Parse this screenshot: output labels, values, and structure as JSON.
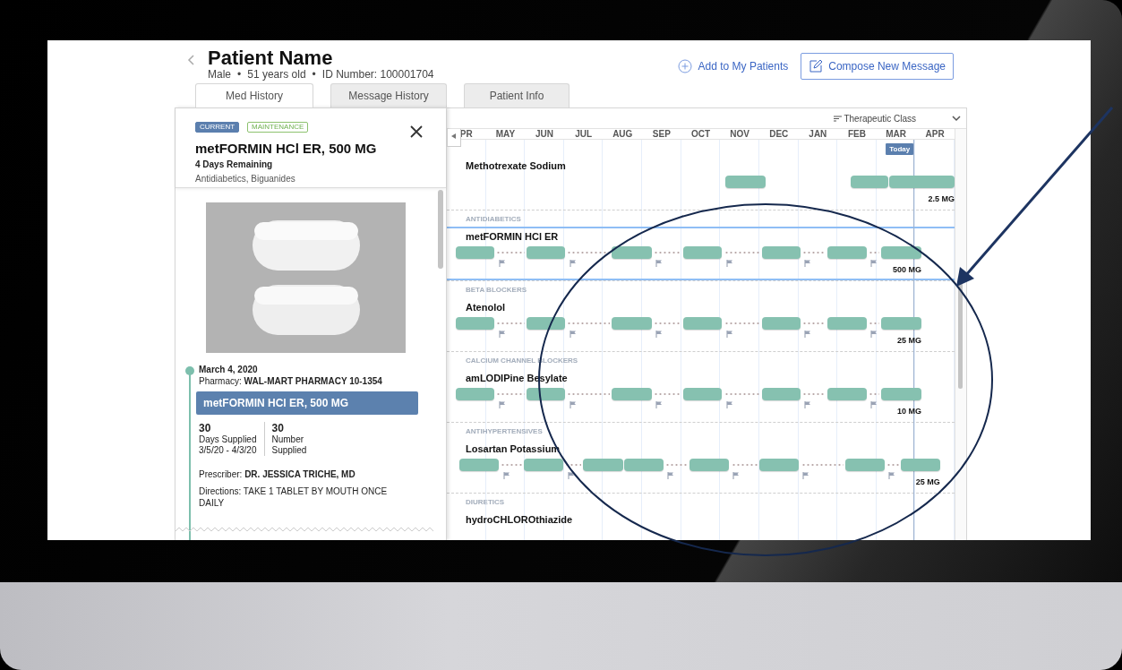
{
  "patient": {
    "name": "Patient Name",
    "separator": "•",
    "details": [
      "Male",
      "51 years old",
      "ID Number: 100001704"
    ]
  },
  "actions": {
    "add": "Add to My Patients",
    "compose": "Compose New Message"
  },
  "tabs": [
    {
      "label": "Med History",
      "selected": true
    },
    {
      "label": "Message History",
      "selected": false
    },
    {
      "label": "Patient Info",
      "selected": false
    }
  ],
  "drug_panel": {
    "badges": [
      {
        "label": "CURRENT",
        "kind": "current"
      },
      {
        "label": "MAINTENANCE",
        "kind": "maintenance"
      }
    ],
    "title": "metFORMIN HCl ER, 500 MG",
    "remaining": "4 Days Remaining",
    "drug_class": "Antidiabetics, Biguanides",
    "fill": {
      "date": "March 4, 2020",
      "pharmacy_label": "Pharmacy:",
      "pharmacy": "WAL-MART PHARMACY 10-1354",
      "product": "metFORMIN HCl ER, 500 MG",
      "stats": [
        {
          "value": "30",
          "label": "Days Supplied",
          "detail": "3/5/20 - 4/3/20"
        },
        {
          "value": "30",
          "label": "Number Supplied"
        }
      ],
      "prescriber_label": "Prescriber:",
      "prescriber": "DR. JESSICA TRICHE, MD",
      "directions_label": "Directions:",
      "directions": "TAKE 1 TABLET BY MOUTH ONCE DAILY"
    }
  },
  "chart": {
    "sort_label": "Therapeutic Class",
    "months": [
      "PR",
      "MAY",
      "JUN",
      "JUL",
      "AUG",
      "SEP",
      "OCT",
      "NOV",
      "DEC",
      "JAN",
      "FEB",
      "MAR",
      "APR"
    ],
    "today_label": "Today",
    "rows": [
      {
        "name": "Methotrexate Sodium",
        "selected": false,
        "dose": "2.5 MG"
      },
      {
        "class_label": "ANTIDIABETICS",
        "name": "metFORMIN HCl ER",
        "selected": true,
        "dose": "500 MG"
      },
      {
        "class_label": "BETA BLOCKERS",
        "name": "Atenolol",
        "selected": false,
        "dose": "25 MG"
      },
      {
        "class_label": "CALCIUM CHANNEL BLOCKERS",
        "name": "amLODIPine Besylate",
        "selected": false,
        "dose": "10 MG"
      },
      {
        "class_label": "ANTIHYPERTENSIVES",
        "name": "Losartan Potassium",
        "selected": false,
        "dose": "25 MG"
      },
      {
        "class_label": "DIURETICS",
        "name": "hydroCHLOROthiazide",
        "selected": false
      }
    ]
  }
}
